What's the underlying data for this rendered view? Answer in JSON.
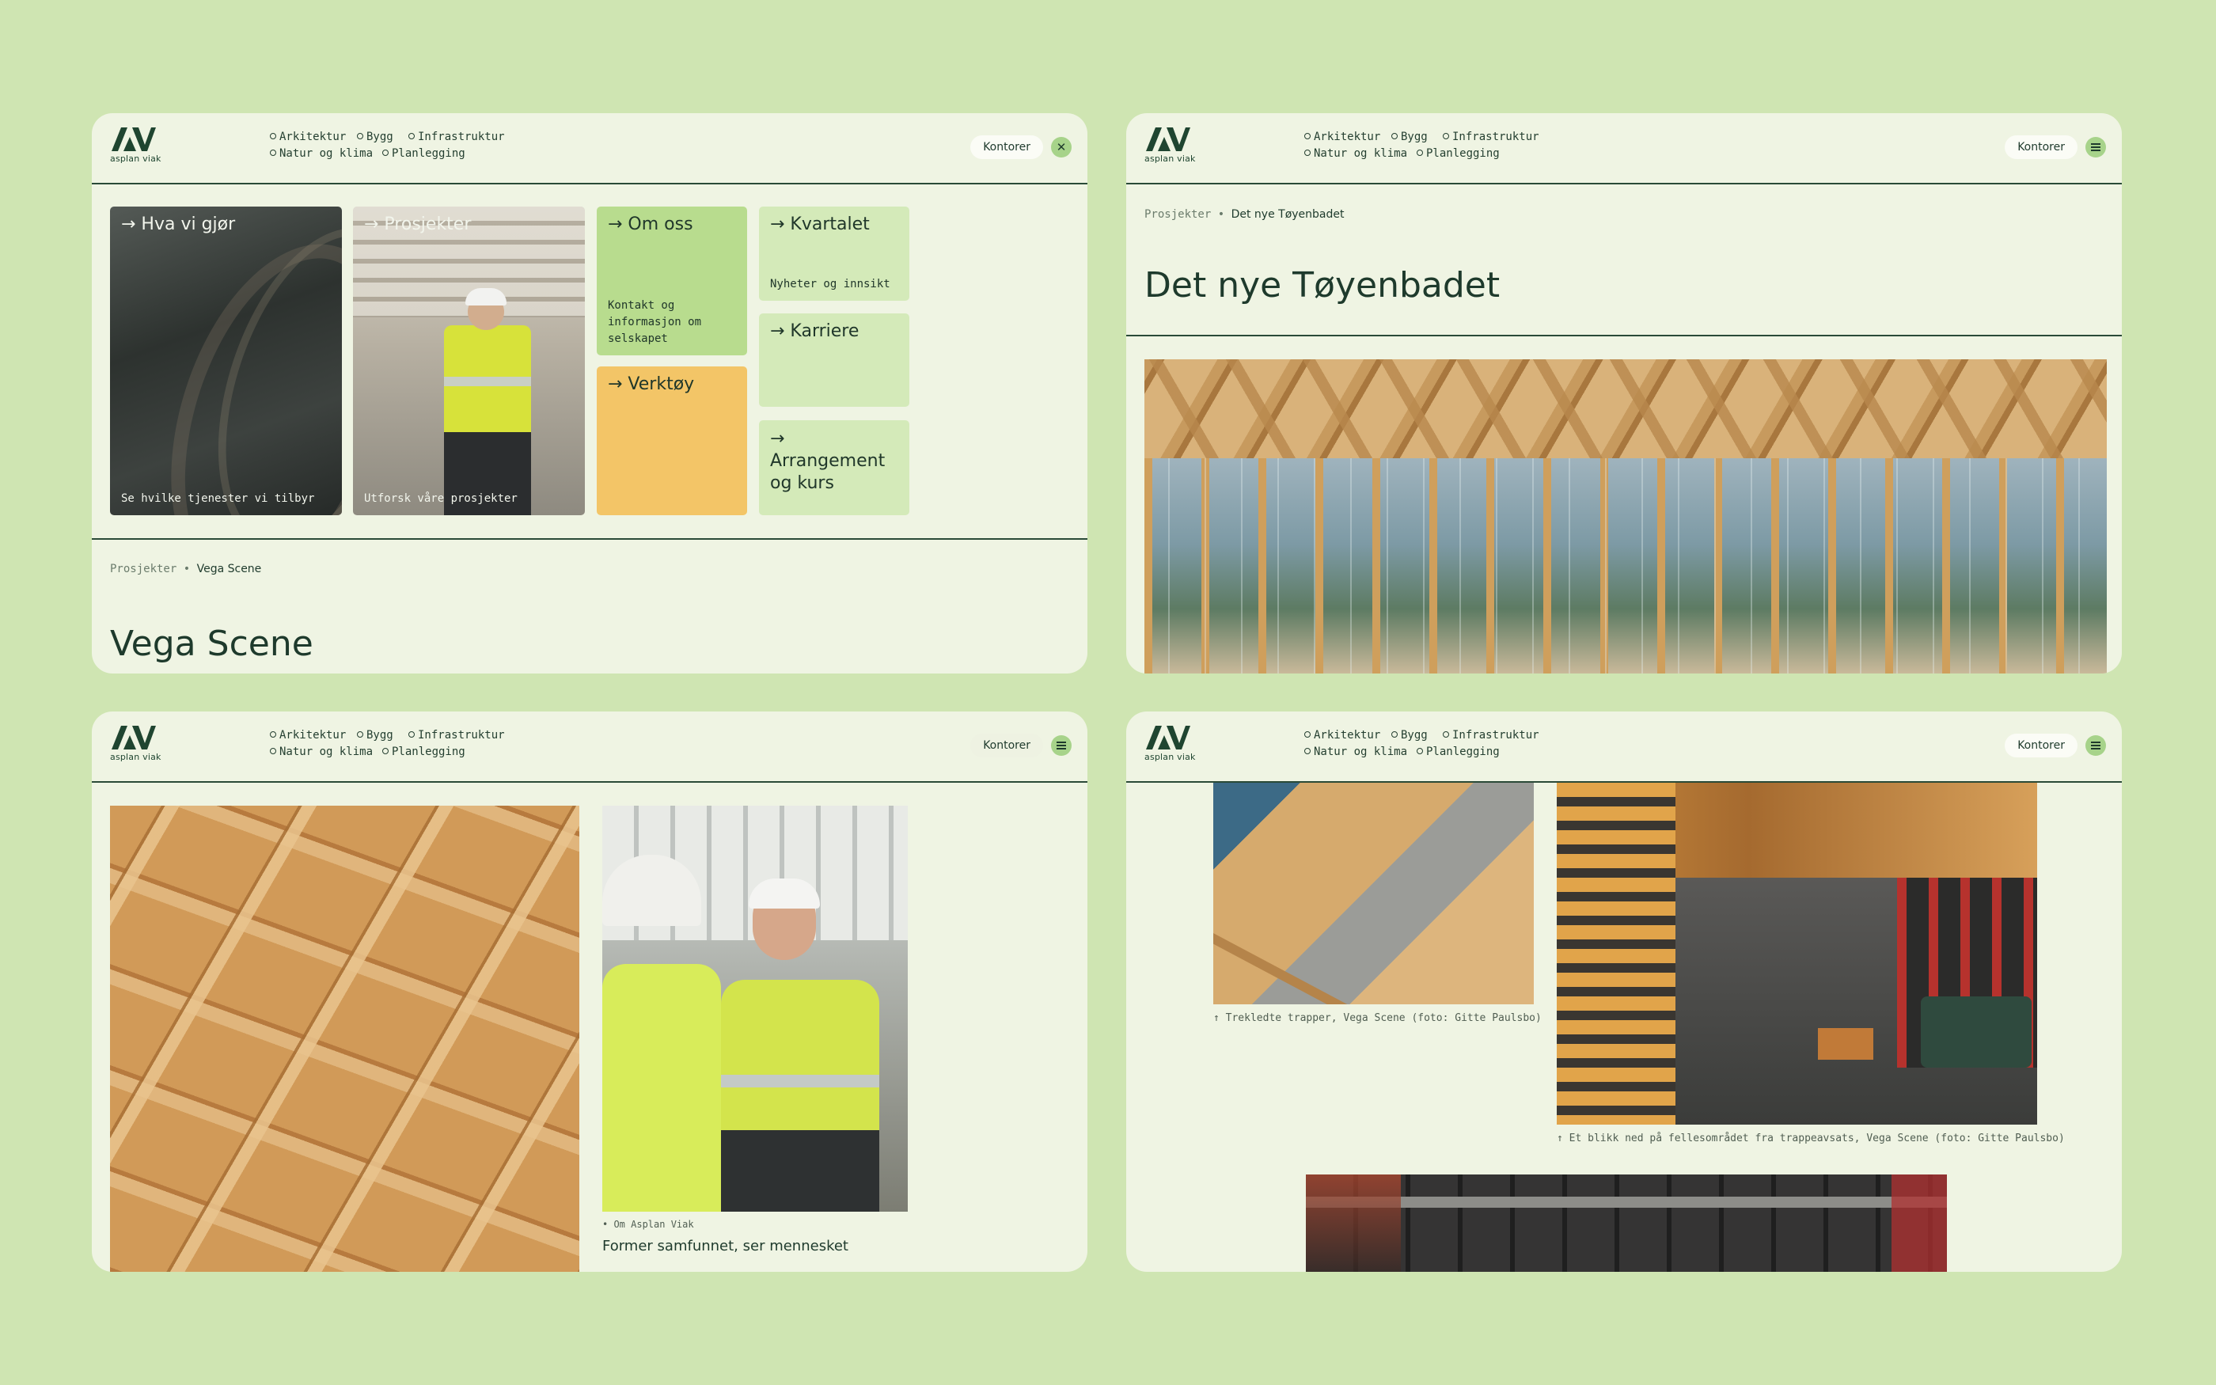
{
  "brand": {
    "logo_text": "asplan viak"
  },
  "nav": {
    "items": [
      "Arkitektur",
      "Bygg",
      "Infrastruktur",
      "Natur og klima",
      "Planlegging"
    ]
  },
  "header": {
    "kontorer_label": "Kontorer"
  },
  "colors": {
    "background": "#cfe5b2",
    "panel": "#eff4e3",
    "accent_green": "#a7d38a",
    "tile_green": "#b8dc8e",
    "tile_light": "#d4eab9",
    "tile_yellow": "#f3c567",
    "ink": "#1e3a2c"
  },
  "panel1": {
    "tiles": [
      {
        "label": "→ Hva vi gjør",
        "sub": "Se hvilke tjenester vi tilbyr"
      },
      {
        "label": "→ Prosjekter",
        "sub": "Utforsk våre prosjekter"
      },
      {
        "label": "→ Om oss",
        "sub": "Kontakt og informasjon om selskapet"
      },
      {
        "label": "→ Verktøy",
        "sub": ""
      },
      {
        "label": "→ Kvartalet",
        "sub": "Nyheter og innsikt"
      },
      {
        "label": "→ Karriere",
        "sub": ""
      },
      {
        "label": "→ Arrangement og kurs",
        "sub": ""
      }
    ],
    "breadcrumb": {
      "parent": "Prosjekter",
      "current": "Vega Scene"
    },
    "title": "Vega Scene"
  },
  "panel2": {
    "breadcrumb": {
      "parent": "Prosjekter",
      "current": "Det nye Tøyenbadet"
    },
    "title": "Det nye Tøyenbadet"
  },
  "panel3": {
    "tag": "Om Asplan Viak",
    "headline": "Former samfunnet, ser mennesket"
  },
  "panel4": {
    "caption1": "Trekledte trapper, Vega Scene (foto: Gitte Paulsbo)",
    "caption2": "Et blikk ned på fellesområdet fra trappeavsats, Vega Scene (foto: Gitte Paulsbo)"
  },
  "icons": {
    "close": "close-icon",
    "menu": "menu-icon",
    "arrow_up": "arrow-up-icon"
  }
}
